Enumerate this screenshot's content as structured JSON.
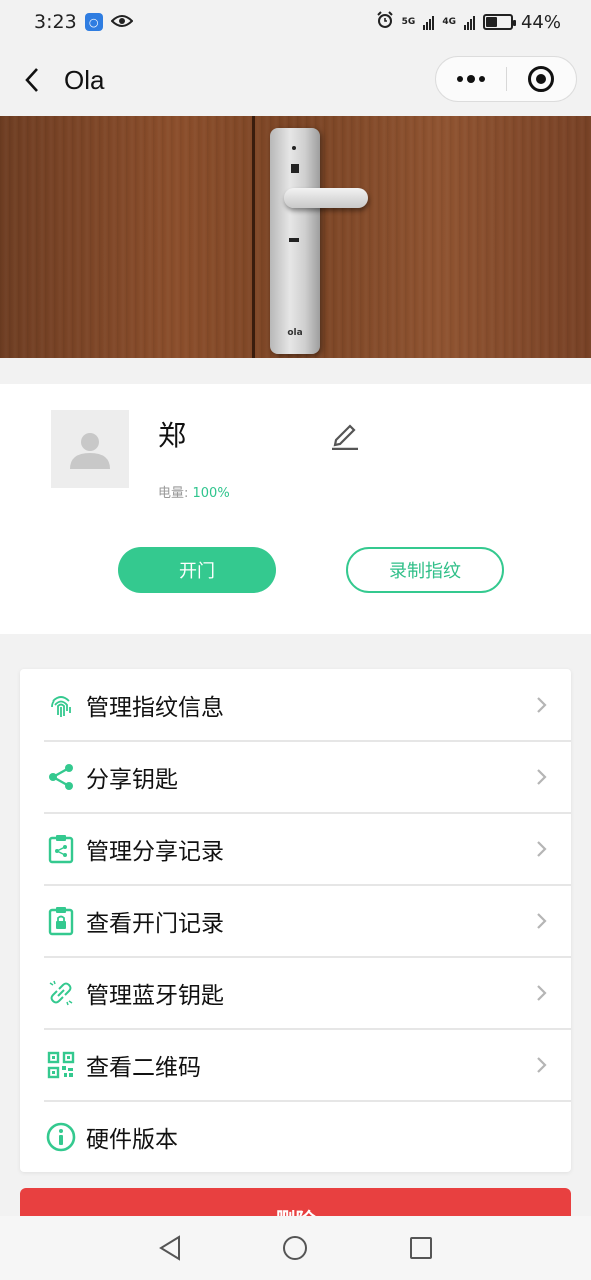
{
  "status_bar": {
    "time": "3:23",
    "badge": "⛴",
    "net1": "5G",
    "net2": "4G",
    "battery_percent_text": "44%",
    "battery_level": 0.44
  },
  "nav": {
    "title": "Ola"
  },
  "banner": {
    "lock_logo": "ola"
  },
  "device": {
    "name": "郑",
    "battery_label": "电量: ",
    "battery_value": "100%",
    "open_button": "开门",
    "record_button": "录制指纹"
  },
  "menu": {
    "items": [
      {
        "label": "管理指纹信息",
        "icon": "fingerprint-icon"
      },
      {
        "label": "分享钥匙",
        "icon": "share-icon"
      },
      {
        "label": "管理分享记录",
        "icon": "clipboard-share-icon"
      },
      {
        "label": "查看开门记录",
        "icon": "clipboard-lock-icon"
      },
      {
        "label": "管理蓝牙钥匙",
        "icon": "link-icon"
      },
      {
        "label": "查看二维码",
        "icon": "qr-code-icon"
      },
      {
        "label": "硬件版本",
        "icon": "info-icon"
      }
    ]
  },
  "delete_button": "删除",
  "colors": {
    "accent": "#34c98f",
    "danger": "#e84040"
  }
}
